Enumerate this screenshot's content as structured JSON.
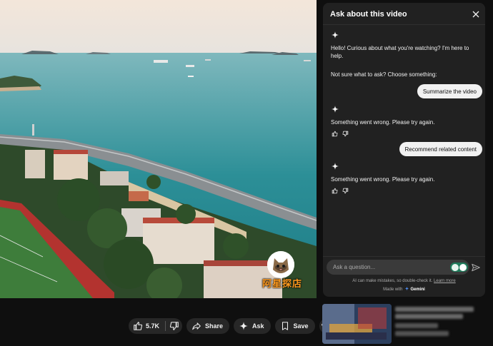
{
  "video": {
    "watermark_text": "阿星探店"
  },
  "actions": {
    "like_count": "5.7K",
    "share_label": "Share",
    "ask_label": "Ask",
    "save_label": "Save",
    "more_label": "•••",
    "icons": [
      "thumb-up-icon",
      "thumb-down-icon",
      "share-arrow-icon",
      "sparkle-icon",
      "bookmark-icon",
      "more-icon"
    ]
  },
  "panel": {
    "title": "Ask about this video",
    "intro": "Hello! Curious about what you're watching? I'm here to help.",
    "prompt": "Not sure what to ask? Choose something:",
    "messages": [
      {
        "role": "user",
        "text": "Summarize the video"
      },
      {
        "role": "assistant",
        "text": "Something went wrong. Please try again."
      },
      {
        "role": "user",
        "text": "Recommend related content"
      },
      {
        "role": "assistant",
        "text": "Something went wrong. Please try again."
      }
    ],
    "input_placeholder": "Ask a question...",
    "disclaimer": "AI can make mistakes, so double-check it.",
    "learn_more": "Learn more",
    "made_with": "Made with",
    "gemini": "Gemini"
  },
  "colors": {
    "background": "#0f0f0f",
    "panel": "#212121",
    "pill": "#272727",
    "user_bubble": "#f1f1f1",
    "watermark": "#ff9a1f"
  }
}
